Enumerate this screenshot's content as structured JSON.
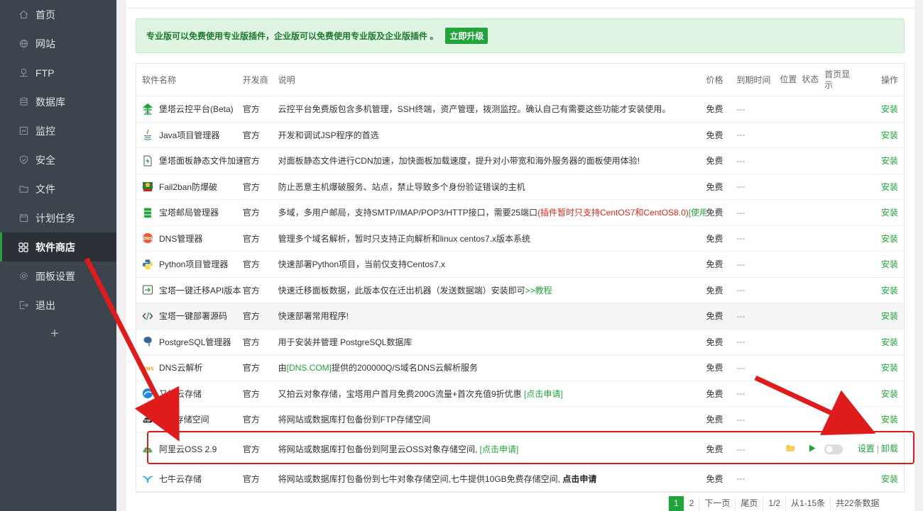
{
  "sidebar": {
    "items": [
      {
        "label": "首页",
        "icon": "home-icon"
      },
      {
        "label": "网站",
        "icon": "globe-icon"
      },
      {
        "label": "FTP",
        "icon": "ftp-icon"
      },
      {
        "label": "数据库",
        "icon": "database-icon"
      },
      {
        "label": "监控",
        "icon": "monitor-icon"
      },
      {
        "label": "安全",
        "icon": "shield-icon"
      },
      {
        "label": "文件",
        "icon": "folder-icon"
      },
      {
        "label": "计划任务",
        "icon": "calendar-icon"
      },
      {
        "label": "软件商店",
        "icon": "apps-grid-icon",
        "active": true
      },
      {
        "label": "面板设置",
        "icon": "gear-icon"
      },
      {
        "label": "退出",
        "icon": "logout-icon"
      }
    ],
    "add_label": "+"
  },
  "notice": {
    "text": "专业版可以免费使用专业版插件，企业版可以免费使用专业版及企业版插件 。",
    "button": "立即升级"
  },
  "table": {
    "headers": {
      "name": "软件名称",
      "developer": "开发商",
      "description": "说明",
      "price": "价格",
      "expire": "到期时间",
      "position": "位置",
      "status": "状态",
      "homepage": "首页显示",
      "action": "操作"
    },
    "rows": [
      {
        "name": "堡塔云控平台(Beta)",
        "icon": "cloud-control-icon",
        "developer": "官方",
        "desc": "云控平台免费版包含多机管理，SSH终端，资产管理，拨测监控。确认自己有需要这些功能才安装使用。",
        "price": "免费",
        "expire": "---",
        "action": "安装"
      },
      {
        "name": "Java项目管理器",
        "icon": "java-icon",
        "developer": "官方",
        "desc": "开发和调试JSP程序的首选",
        "price": "免费",
        "expire": "---",
        "action": "安装"
      },
      {
        "name": "堡塔面板静态文件加速",
        "icon": "lightning-file-icon",
        "developer": "官方",
        "desc": "对面板静态文件进行CDN加速，加快面板加载速度，提升对小带宽和海外服务器的面板使用体验!",
        "price": "免费",
        "expire": "---",
        "action": "安装"
      },
      {
        "name": "Fail2ban防爆破",
        "icon": "fail2ban-icon",
        "developer": "官方",
        "desc": "防止恶意主机爆破服务、站点，禁止导致多个身份验证错误的主机",
        "price": "免费",
        "expire": "---",
        "action": "安装"
      },
      {
        "name": "宝塔邮局管理器",
        "icon": "mail-server-icon",
        "developer": "官方",
        "desc": "多域，多用户邮局，支持SMTP/IMAP/POP3/HTTP接口，需要25端口",
        "desc_red": "(插件暂时只支持CentOS7和CentOS8.0)",
        "desc_green": "[使用帮助]",
        "price": "免费",
        "expire": "---",
        "action": "安装"
      },
      {
        "name": "DNS管理器",
        "icon": "dns-icon",
        "developer": "官方",
        "desc": "管理多个域名解析，暂时只支持正向解析和linux centos7.x版本系统",
        "price": "免费",
        "expire": "---",
        "action": "安装"
      },
      {
        "name": "Python项目管理器",
        "icon": "python-icon",
        "developer": "官方",
        "desc": "快速部署Python项目，当前仅支持Centos7.x",
        "price": "免费",
        "expire": "---",
        "action": "安装"
      },
      {
        "name": "宝塔一键迁移API版本",
        "icon": "migrate-icon",
        "developer": "官方",
        "desc": "快速迁移面板数据，此版本仅在迁出机器（发送数据端）安装即可",
        "desc_green": ">>教程",
        "price": "免费",
        "expire": "---",
        "action": "安装"
      },
      {
        "name": "宝塔一键部署源码",
        "icon": "code-icon",
        "developer": "官方",
        "desc": "快速部署常用程序!",
        "price": "免费",
        "expire": "---",
        "action": "安装"
      },
      {
        "name": "PostgreSQL管理器",
        "icon": "postgresql-icon",
        "developer": "官方",
        "desc": "用于安装并管理 PostgreSQL数据库",
        "price": "免费",
        "expire": "---",
        "action": "安装"
      },
      {
        "name": "DNS云解析",
        "icon": "dnscom-icon",
        "developer": "官方",
        "desc_pre": "由",
        "desc_green": "[DNS.COM]",
        "desc": "提供的200000Q/S域名DNS云解析服务",
        "price": "免费",
        "expire": "---",
        "action": "安装"
      },
      {
        "name": "又拍云存储",
        "icon": "upyun-icon",
        "developer": "官方",
        "desc": "又拍云对象存储，宝塔用户首月免费200G流量+首次充值9折优惠 ",
        "desc_green": "[点击申请]",
        "price": "免费",
        "expire": "---",
        "action": "安装"
      },
      {
        "name": "FTP存储空间",
        "icon": "ftp-cloud-icon",
        "developer": "官方",
        "desc": "将网站或数据库打包备份到FTP存储空间",
        "price": "免费",
        "expire": "---",
        "action": "安装"
      },
      {
        "name": "阿里云OSS 2.9",
        "icon": "aliyun-oss-icon",
        "developer": "官方",
        "desc": "将网站或数据库打包备份到阿里云OSS对象存储空间, ",
        "desc_green": "[点击申请]",
        "price": "免费",
        "expire": "---",
        "action_set": "设置",
        "action_sep": "|",
        "action_uninstall": "卸载",
        "installed": true
      },
      {
        "name": "七牛云存储",
        "icon": "qiniu-icon",
        "developer": "官方",
        "desc": "将网站或数据库打包备份到七牛对象存储空间,七牛提供10GB免费存储空间, ",
        "desc_bold": "点击申请",
        "price": "免费",
        "expire": "---",
        "action": "安装"
      }
    ]
  },
  "pager": {
    "pages": [
      "1",
      "2"
    ],
    "next": "下一页",
    "last": "尾页",
    "page_info": "1/2",
    "range": "从1-15条",
    "total": "共22条数据"
  },
  "colors": {
    "accent": "#20a53a",
    "sidebar": "#3c444d",
    "highlight": "#e01b1b"
  }
}
